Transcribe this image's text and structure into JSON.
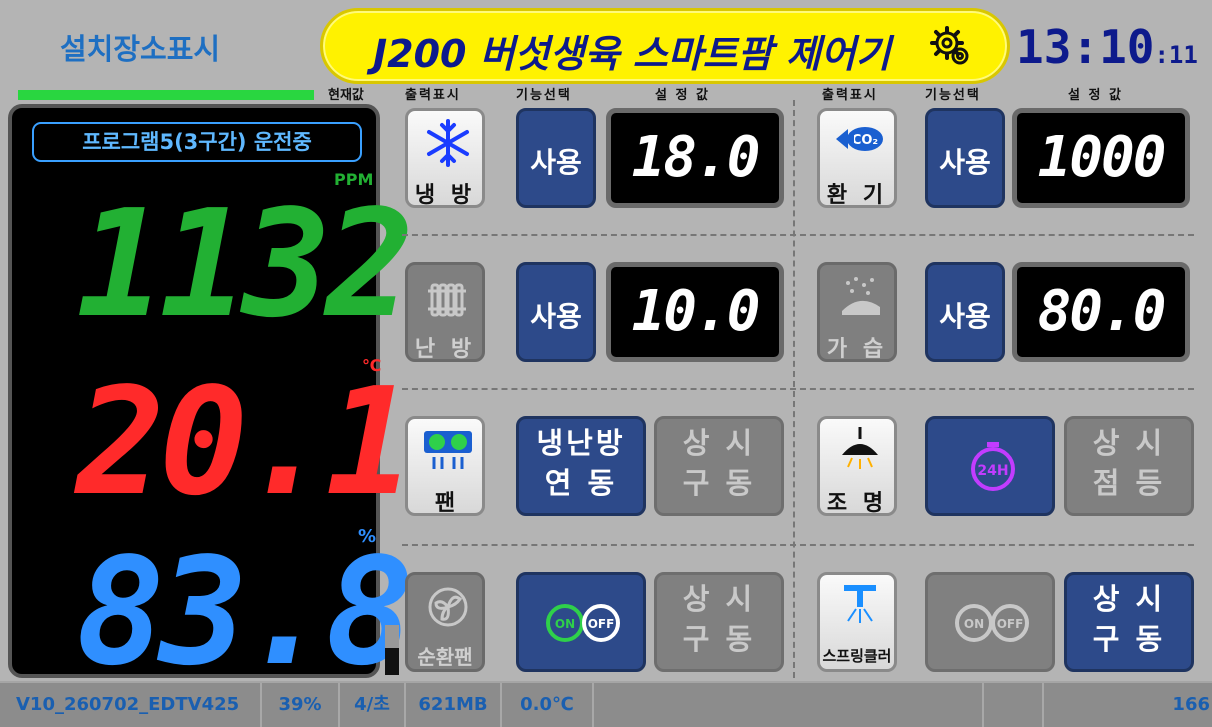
{
  "header": {
    "location_label": "설치장소표시",
    "title": "J200 버섯생육 스마트팜 제어기",
    "clock_hm": "13:10",
    "clock_sec": ":11"
  },
  "columns": {
    "current": "현재값",
    "left": {
      "output": "출력표시",
      "func": "기능선택",
      "setval": "설 정 값"
    },
    "right": {
      "output": "출력표시",
      "func": "기능선택",
      "setval": "설 정 값"
    }
  },
  "monitor": {
    "program_status": "프로그램5(3구간) 운전중",
    "co2_unit": "PPM",
    "co2_value": "1132",
    "temp_unit": "℃",
    "temp_value": "20.1",
    "humid_unit": "%",
    "humid_value": "83.8",
    "level_fraction": 0.55
  },
  "rows": {
    "cooling": {
      "label": "냉 방",
      "func": "사용",
      "setpoint": "18.0",
      "icon": "snowflake-icon"
    },
    "ventilation": {
      "label": "환 기",
      "func": "사용",
      "setpoint": "1000",
      "icon": "co2-ventilation-icon"
    },
    "heating": {
      "label": "난 방",
      "func": "사용",
      "setpoint": "10.0",
      "icon": "radiator-icon"
    },
    "humidify": {
      "label": "가 습",
      "func": "사용",
      "setpoint": "80.0",
      "icon": "humidifier-icon"
    },
    "fan": {
      "label": "팬",
      "func_line1": "냉난방",
      "func_line2": "연 동",
      "mode_line1": "상 시",
      "mode_line2": "구 동",
      "icon": "fan-icon"
    },
    "lighting": {
      "label": "조 명",
      "mode_line1": "상 시",
      "mode_line2": "점 등",
      "icon": "lamp-icon",
      "timer_icon": "24h-timer-icon"
    },
    "circulation": {
      "label": "순환팬",
      "mode_line1": "상 시",
      "mode_line2": "구 동",
      "icon": "circulation-fan-icon",
      "timer_icon": "on-off-timer-icon"
    },
    "sprinkler": {
      "label": "스프링클러",
      "mode_line1": "상 시",
      "mode_line2": "구 동",
      "icon": "sprinkler-icon",
      "timer_icon": "on-off-timer-icon"
    }
  },
  "status_bar": {
    "version": "V10_260702_EDTV425",
    "percent": "39%",
    "rate": "4/초",
    "memory": "621MB",
    "temp": "0.0℃",
    "counter": "166"
  },
  "colors": {
    "title_bg": "#fff200",
    "co2": "#22b033",
    "temp": "#ff2a2a",
    "humid": "#2f8fff",
    "active_blue": "#2d4a8a"
  }
}
